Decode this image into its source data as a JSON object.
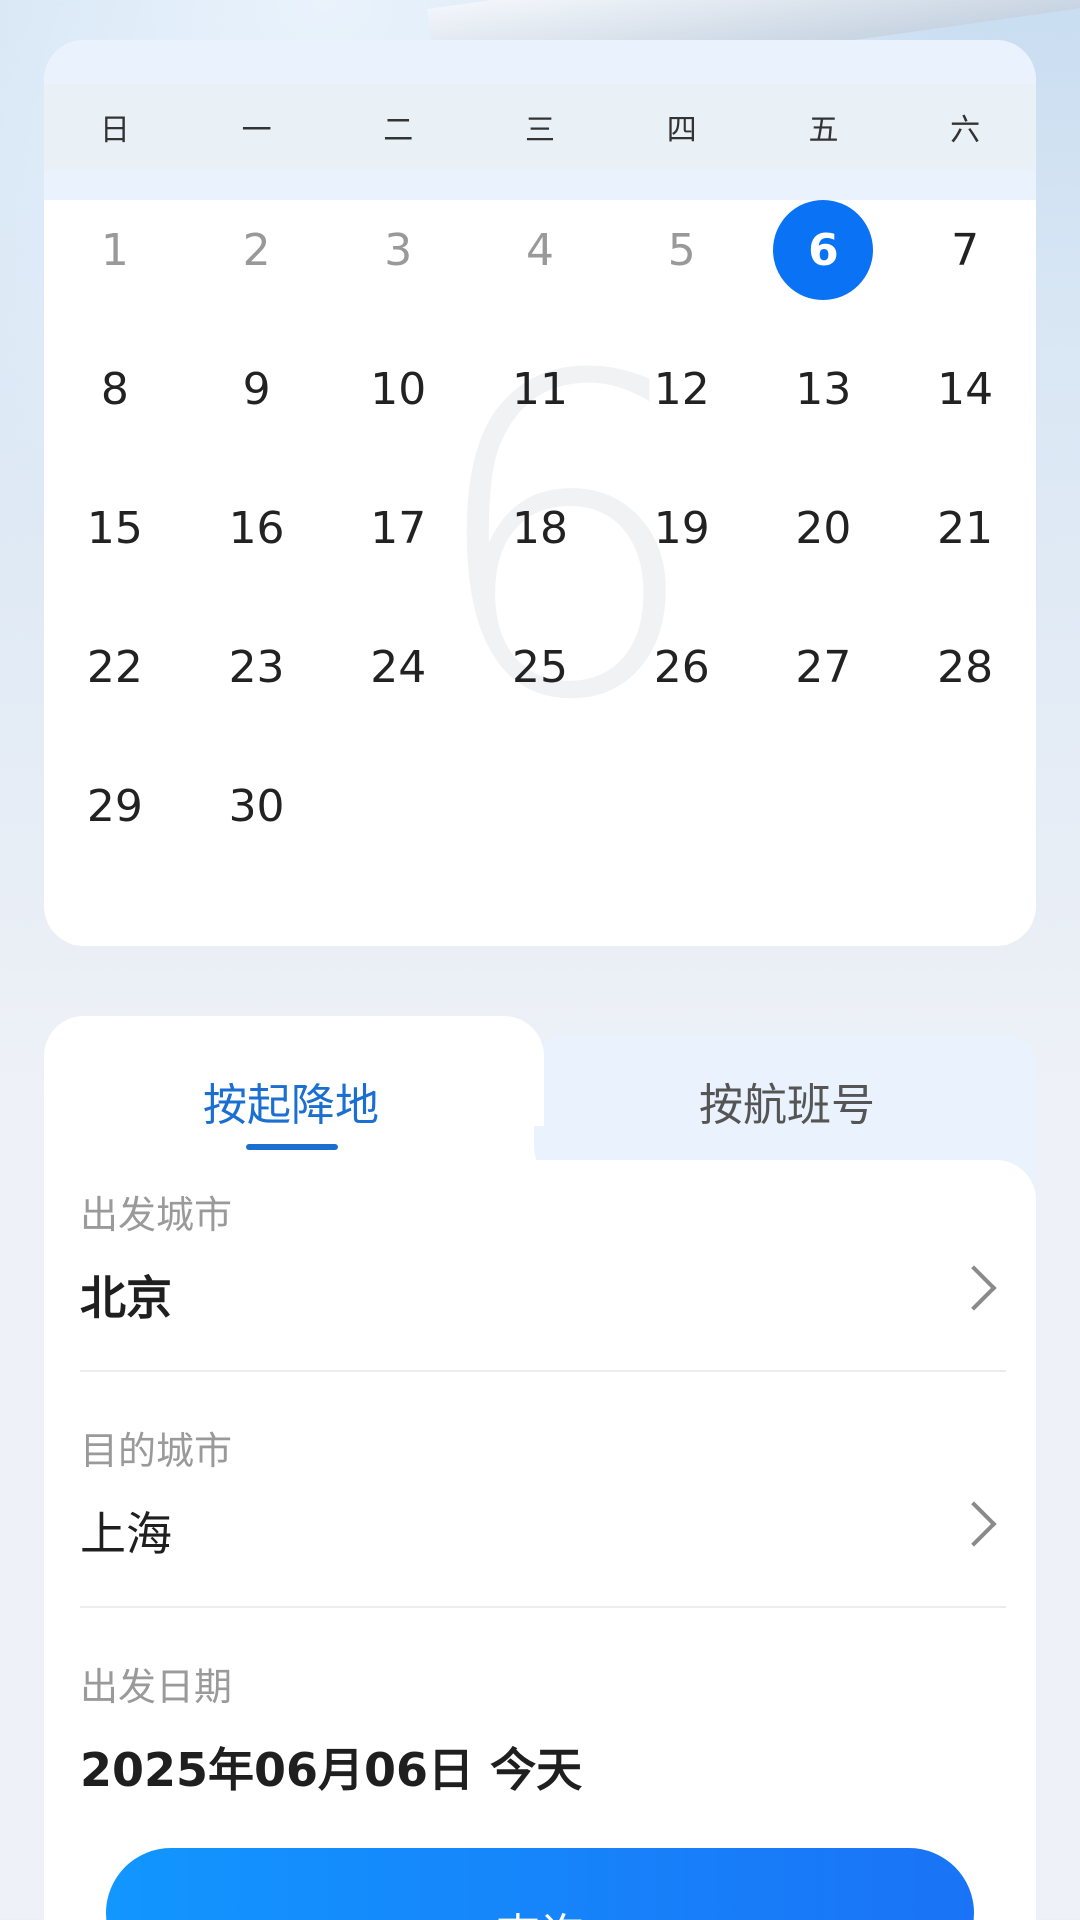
{
  "calendar": {
    "month_watermark": "6",
    "weekdays": [
      "日",
      "一",
      "二",
      "三",
      "四",
      "五",
      "六"
    ],
    "days": [
      "1",
      "2",
      "3",
      "4",
      "5",
      "6",
      "7",
      "8",
      "9",
      "10",
      "11",
      "12",
      "13",
      "14",
      "15",
      "16",
      "17",
      "18",
      "19",
      "20",
      "21",
      "22",
      "23",
      "24",
      "25",
      "26",
      "27",
      "28",
      "29",
      "30"
    ],
    "selected_day": "6",
    "accent_color": "#0a73f5"
  },
  "search": {
    "tabs": [
      {
        "label": "按起降地",
        "active": true
      },
      {
        "label": "按航班号",
        "active": false
      }
    ],
    "fields": {
      "departure": {
        "label": "出发城市",
        "value": "北京"
      },
      "destination": {
        "label": "目的城市",
        "value": "上海"
      },
      "date": {
        "label": "出发日期",
        "value": "2025年06月06日 今天"
      }
    },
    "query_label": "查询",
    "accent_color": "#1a6fd1"
  }
}
